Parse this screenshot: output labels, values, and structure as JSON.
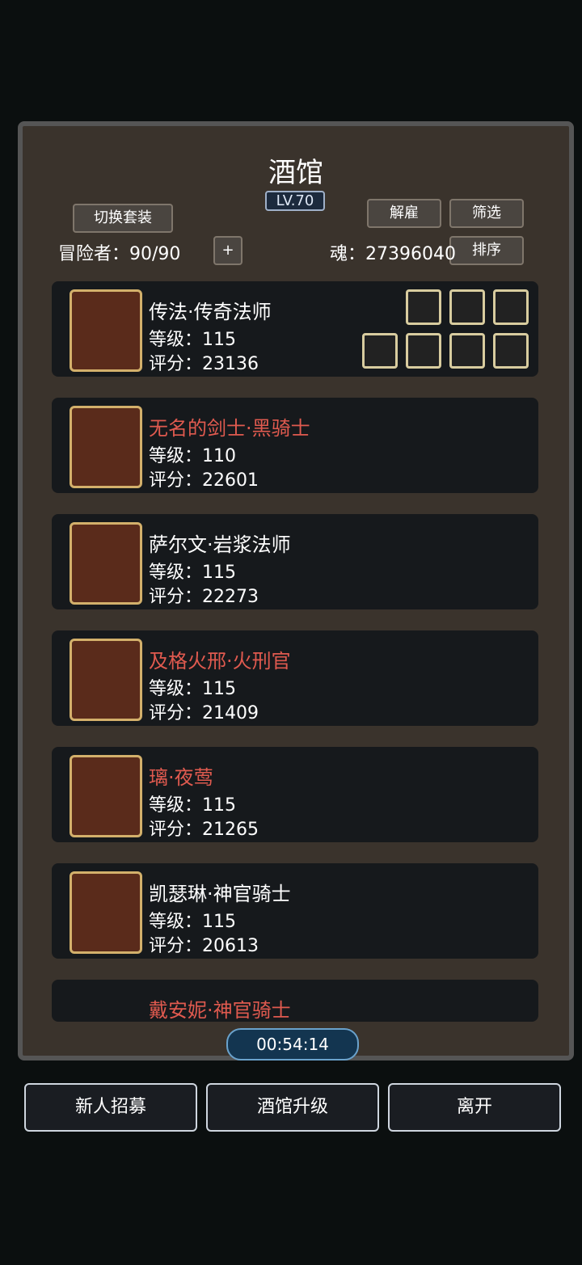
{
  "panel": {
    "title": "酒馆",
    "level": "LV.70",
    "adventurer_label": "冒险者：",
    "adventurer_count": "90/90",
    "soul_label": "魂：",
    "soul_value": "27396040"
  },
  "buttons": {
    "switch": "切换套装",
    "dismiss": "解雇",
    "filter": "筛选",
    "sort": "排序",
    "add": "+"
  },
  "heroes": [
    {
      "name": "传法·传奇法师",
      "level": "等级：115",
      "score": "评分：23136"
    },
    {
      "name": "无名的剑士·黑骑士",
      "level": "等级：110",
      "score": "评分：22601"
    },
    {
      "name": "萨尔文·岩浆法师",
      "level": "等级：115",
      "score": "评分：22273"
    },
    {
      "name": "及格火邢·火刑官",
      "level": "等级：115",
      "score": "评分：21409"
    },
    {
      "name": "璃·夜莺",
      "level": "等级：115",
      "score": "评分：21265"
    },
    {
      "name": "凯瑟琳·神官骑士",
      "level": "等级：115",
      "score": "评分：20613"
    },
    {
      "name": "戴安妮·神官骑士",
      "level": "",
      "score": ""
    }
  ],
  "timer": "00:54:14",
  "bottom": {
    "recruit": "新人招募",
    "upgrade": "酒馆升级",
    "leave": "离开"
  }
}
